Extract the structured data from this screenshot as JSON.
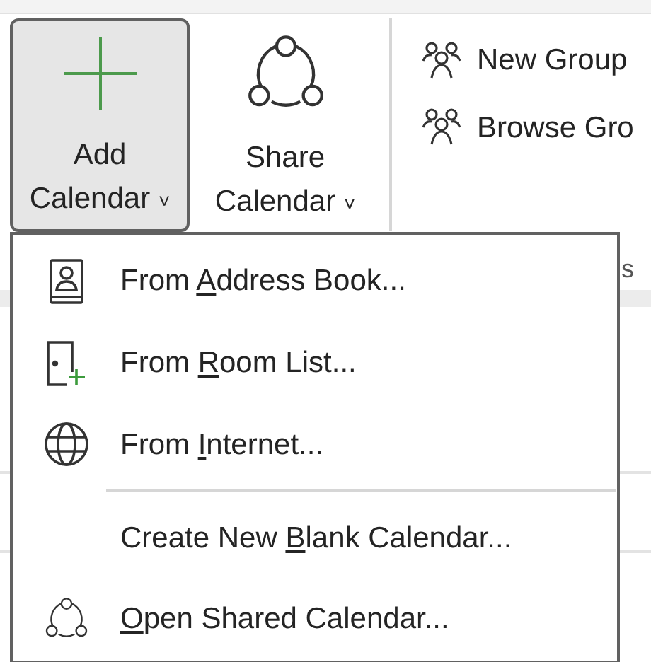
{
  "ribbon": {
    "buttons": [
      {
        "kind": "add",
        "line1": "Add",
        "line2": "Calendar",
        "caret": "˅",
        "pressed": true
      },
      {
        "kind": "share",
        "line1": "Share",
        "line2": "Calendar",
        "caret": "˅",
        "pressed": false
      }
    ],
    "group_items": [
      {
        "label": "New Group"
      },
      {
        "label": "Browse Gro"
      }
    ],
    "group_label": "s"
  },
  "menu": {
    "items": [
      {
        "kind": "address-book",
        "before": "From ",
        "key": "A",
        "after": "ddress Book..."
      },
      {
        "kind": "room",
        "before": "From ",
        "key": "R",
        "after": "oom List..."
      },
      {
        "kind": "globe",
        "before": "From ",
        "key": "I",
        "after": "nternet..."
      },
      {
        "kind": "separator"
      },
      {
        "kind": "blank",
        "before": "Create New ",
        "key": "B",
        "after": "lank Calendar..."
      },
      {
        "kind": "shared",
        "key": "O",
        "after": "pen Shared Calendar..."
      }
    ]
  }
}
